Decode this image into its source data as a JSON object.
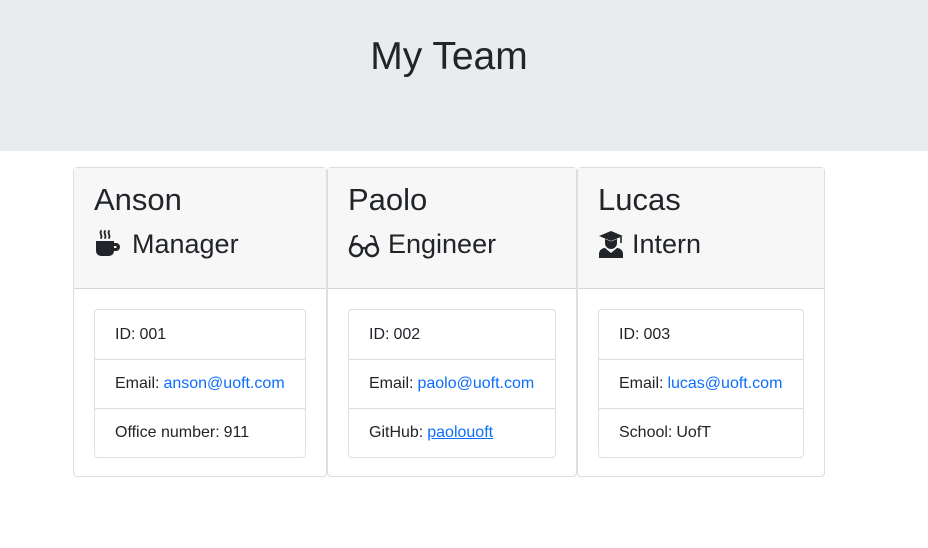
{
  "header": {
    "title": "My Team"
  },
  "team": [
    {
      "name": "Anson",
      "role": "Manager",
      "icon": "coffee-icon",
      "id_label": "ID:",
      "id": "001",
      "email_label": "Email:",
      "email": "anson@uoft.com",
      "extra_label": "Office number:",
      "extra_value": "911"
    },
    {
      "name": "Paolo",
      "role": "Engineer",
      "icon": "glasses-icon",
      "id_label": "ID:",
      "id": "002",
      "email_label": "Email:",
      "email": "paolo@uoft.com",
      "extra_label": "GitHub:",
      "extra_value": "paolouoft"
    },
    {
      "name": "Lucas",
      "role": "Intern",
      "icon": "graduate-icon",
      "id_label": "ID:",
      "id": "003",
      "email_label": "Email:",
      "email": "lucas@uoft.com",
      "extra_label": "School:",
      "extra_value": "UofT"
    }
  ],
  "colors": {
    "link": "#0d6efd",
    "jumbotron": "#e9ecef",
    "header_bg": "#f7f7f7"
  }
}
